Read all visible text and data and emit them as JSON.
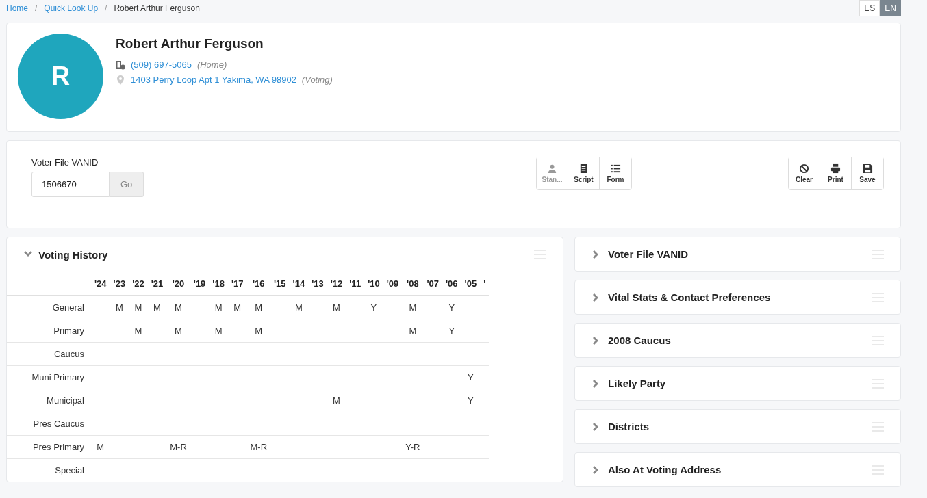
{
  "breadcrumb": [
    {
      "label": "Home",
      "kind": "link"
    },
    {
      "label": "/",
      "kind": "separator"
    },
    {
      "label": "Quick Look Up",
      "kind": "link"
    },
    {
      "label": "/",
      "kind": "separator"
    },
    {
      "label": "Robert Arthur Ferguson",
      "kind": "current"
    }
  ],
  "languages": [
    {
      "label": "ES",
      "selected": false
    },
    {
      "label": "EN",
      "selected": true
    }
  ],
  "profile": {
    "initial": "R",
    "name": "Robert Arthur Ferguson",
    "phone": "(509) 697-5065",
    "phone_type": "(Home)",
    "address": "1403 Perry Loop Apt 1 Yakima, WA 98902",
    "address_type": "(Voting)"
  },
  "lookup": {
    "label": "Voter File VANID",
    "value": "1506670",
    "button": "Go"
  },
  "tools": [
    {
      "label": "Stan...",
      "kind": "person",
      "disabled": true
    },
    {
      "label": "Script",
      "kind": "script",
      "disabled": false
    },
    {
      "label": "Form",
      "kind": "list",
      "disabled": false
    }
  ],
  "actions": [
    {
      "label": "Clear",
      "kind": "ban"
    },
    {
      "label": "Print",
      "kind": "print"
    },
    {
      "label": "Save",
      "kind": "save"
    }
  ],
  "voting_history": {
    "title": "Voting History",
    "expanded": true,
    "years": [
      "'24",
      "'23",
      "'22",
      "'21",
      "'20",
      "'19",
      "'18",
      "'17",
      "'16",
      "'15",
      "'14",
      "'13",
      "'12",
      "'11",
      "'10",
      "'09",
      "'08",
      "'07",
      "'06",
      "'05",
      "'"
    ],
    "rows": [
      {
        "label": "General",
        "cells": [
          "",
          "M",
          "M",
          "M",
          "M",
          "",
          "M",
          "M",
          "M",
          "",
          "M",
          "",
          "M",
          "",
          "Y",
          "",
          "M",
          "",
          "Y",
          "",
          ""
        ]
      },
      {
        "label": "Primary",
        "cells": [
          "",
          "",
          "M",
          "",
          "M",
          "",
          "M",
          "",
          "M",
          "",
          "",
          "",
          "",
          "",
          "",
          "",
          "M",
          "",
          "Y",
          "",
          ""
        ]
      },
      {
        "label": "Caucus",
        "cells": [
          "",
          "",
          "",
          "",
          "",
          "",
          "",
          "",
          "",
          "",
          "",
          "",
          "",
          "",
          "",
          "",
          "",
          "",
          "",
          "",
          ""
        ]
      },
      {
        "label": "Muni Primary",
        "cells": [
          "",
          "",
          "",
          "",
          "",
          "",
          "",
          "",
          "",
          "",
          "",
          "",
          "",
          "",
          "",
          "",
          "",
          "",
          "",
          "Y",
          ""
        ]
      },
      {
        "label": "Municipal",
        "cells": [
          "",
          "",
          "",
          "",
          "",
          "",
          "",
          "",
          "",
          "",
          "",
          "",
          "M",
          "",
          "",
          "",
          "",
          "",
          "",
          "Y",
          ""
        ]
      },
      {
        "label": "Pres Caucus",
        "cells": [
          "",
          "",
          "",
          "",
          "",
          "",
          "",
          "",
          "",
          "",
          "",
          "",
          "",
          "",
          "",
          "",
          "",
          "",
          "",
          "",
          ""
        ]
      },
      {
        "label": "Pres Primary",
        "cells": [
          "M",
          "",
          "",
          "",
          "M-R",
          "",
          "",
          "",
          "M-R",
          "",
          "",
          "",
          "",
          "",
          "",
          "",
          "Y-R",
          "",
          "",
          "",
          ""
        ]
      },
      {
        "label": "Special",
        "cells": [
          "",
          "",
          "",
          "",
          "",
          "",
          "",
          "",
          "",
          "",
          "",
          "",
          "",
          "",
          "",
          "",
          "",
          "",
          "",
          "",
          ""
        ]
      }
    ]
  },
  "panels": [
    {
      "title": "Voter File VANID",
      "expanded": false
    },
    {
      "title": "Vital Stats & Contact Preferences",
      "expanded": false
    },
    {
      "title": "2008 Caucus",
      "expanded": false
    },
    {
      "title": "Likely Party",
      "expanded": false
    },
    {
      "title": "Districts",
      "expanded": false
    },
    {
      "title": "Also At Voting Address",
      "expanded": false
    }
  ]
}
